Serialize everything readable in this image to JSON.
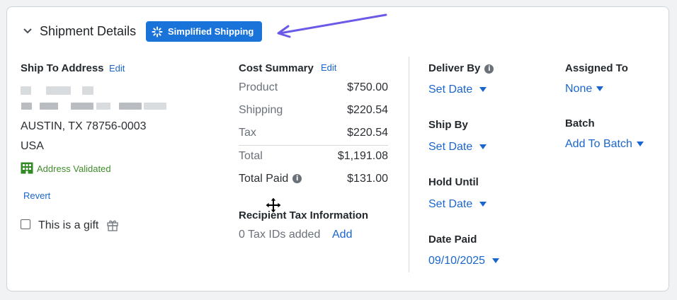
{
  "header": {
    "title": "Shipment Details",
    "badge_label": "Simplified Shipping"
  },
  "ship_to": {
    "label": "Ship To Address",
    "edit_label": "Edit",
    "city_line": "AUSTIN, TX 78756-0003",
    "country": "USA",
    "validated_label": "Address Validated",
    "revert_label": "Revert",
    "gift_label": "This is a gift"
  },
  "cost_summary": {
    "label": "Cost Summary",
    "edit_label": "Edit",
    "rows": [
      {
        "label": "Product",
        "value": "$750.00"
      },
      {
        "label": "Shipping",
        "value": "$220.54"
      },
      {
        "label": "Tax",
        "value": "$220.54"
      }
    ],
    "total_label": "Total",
    "total_value": "$1,191.08",
    "paid_label": "Total Paid",
    "paid_value": "$131.00"
  },
  "tax_info": {
    "label": "Recipient Tax Information",
    "count_text": "0 Tax IDs added",
    "add_label": "Add"
  },
  "dates": {
    "deliver_by": {
      "label": "Deliver By",
      "value": "Set Date"
    },
    "ship_by": {
      "label": "Ship By",
      "value": "Set Date"
    },
    "hold_until": {
      "label": "Hold Until",
      "value": "Set Date"
    },
    "date_paid": {
      "label": "Date Paid",
      "value": "09/10/2025"
    }
  },
  "assigned_to": {
    "label": "Assigned To",
    "value": "None"
  },
  "batch": {
    "label": "Batch",
    "value": "Add To Batch"
  },
  "colors": {
    "accent": "#1a73d9",
    "link": "#1a66cc",
    "validated": "#3f8d2b",
    "arrow": "#6a5ae8"
  }
}
